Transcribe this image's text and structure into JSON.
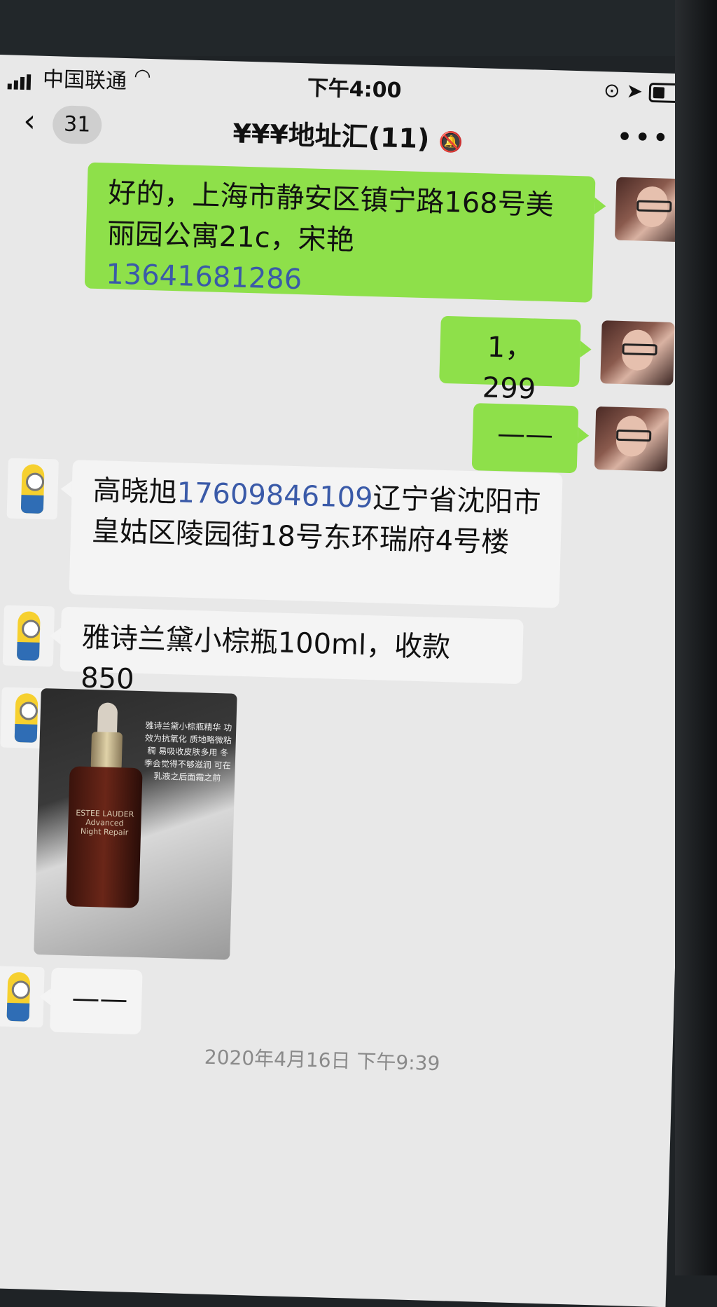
{
  "status_bar": {
    "carrier": "中国联通",
    "time": "下午4:00"
  },
  "nav": {
    "unread_count": "31",
    "title": "¥¥¥地址汇(11)"
  },
  "messages": [
    {
      "side": "right",
      "text": "好的，上海市静安区镇宁路168号美丽园公寓21c，宋艳",
      "phone": "13641681286"
    },
    {
      "side": "right",
      "text": "1，299"
    },
    {
      "side": "right",
      "text": "——"
    },
    {
      "side": "left",
      "name_text": "高晓旭",
      "phone": "17609846109",
      "text": "辽宁省沈阳市皇姑区陵园街18号东环瑞府4号楼"
    },
    {
      "side": "left",
      "text": "雅诗兰黛小棕瓶100ml，收款850"
    },
    {
      "side": "left",
      "type": "image"
    },
    {
      "side": "left",
      "text": "——"
    }
  ],
  "image_ad": {
    "brand": "ESTEE LAUDER",
    "product": "Advanced Night Repair",
    "caption": "雅诗兰黛小棕瓶精华 功效为抗氧化 质地略微粘稠 易吸收皮肤多用 冬季会觉得不够滋润 可在乳液之后面霜之前"
  },
  "timestamp": "2020年4月16日 下午9:39",
  "icons": [
    "signal-icon",
    "wifi-icon",
    "rotation-lock-icon",
    "location-icon",
    "battery-icon",
    "back-chevron-icon",
    "mute-bell-icon",
    "more-icon"
  ]
}
